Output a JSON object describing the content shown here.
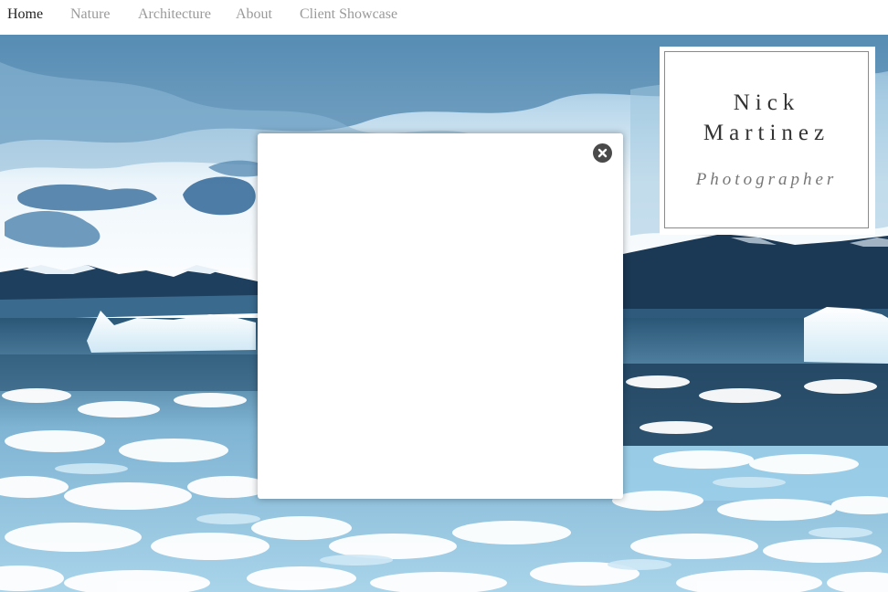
{
  "nav": {
    "items": [
      {
        "label": "Home",
        "active": true
      },
      {
        "label": "Nature",
        "active": false
      },
      {
        "label": "Architecture",
        "active": false
      },
      {
        "label": "About",
        "active": false
      },
      {
        "label": "Client Showcase",
        "active": false
      }
    ]
  },
  "brand": {
    "first_name": "Nick",
    "last_name": "Martinez",
    "subtitle": "Photographer"
  },
  "modal": {
    "close_icon": "close-icon"
  },
  "colors": {
    "nav_active": "#222222",
    "nav_inactive": "#9a9a9a",
    "close_button": "#4a4a4a",
    "deep_water": "#1d3f5c",
    "sky": "#cfe6f4"
  }
}
